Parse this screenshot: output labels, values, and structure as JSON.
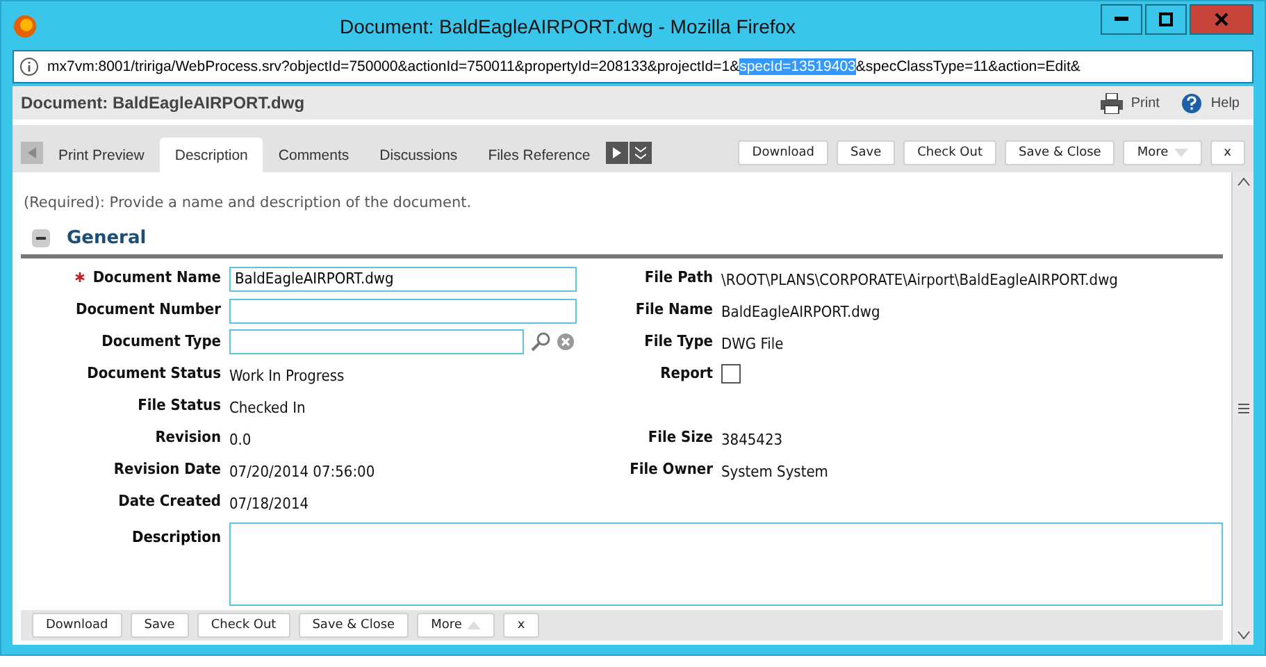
{
  "window": {
    "title": "Document: BaldEagleAIRPORT.dwg - Mozilla Firefox"
  },
  "address_bar": {
    "url_before": "mx7vm:8001/tririga/WebProcess.srv?objectId=750000&actionId=750011&propertyId=208133&projectId=1&",
    "url_selected": "specId=13519403",
    "url_after": "&specClassType=11&action=Edit&"
  },
  "header": {
    "title": "Document: BaldEagleAIRPORT.dwg",
    "actions": [
      {
        "kind": "print",
        "label": "Print"
      },
      {
        "kind": "help",
        "label": "Help"
      }
    ]
  },
  "tabs": [
    {
      "label": "Print Preview",
      "selected": false
    },
    {
      "label": "Description",
      "selected": true
    },
    {
      "label": "Comments",
      "selected": false
    },
    {
      "label": "Discussions",
      "selected": false
    },
    {
      "label": "Files Reference",
      "selected": false
    }
  ],
  "top_buttons": [
    {
      "label": "Download"
    },
    {
      "label": "Save"
    },
    {
      "label": "Check Out"
    },
    {
      "label": "Save & Close"
    },
    {
      "label": "More",
      "kind": "menu"
    },
    {
      "label": "x"
    }
  ],
  "instruction": "(Required): Provide a name and description of the document.",
  "section": {
    "title": "General",
    "expanded": true
  },
  "rows": [
    {
      "left": {
        "label": "Document Name",
        "required": true,
        "kind": "input",
        "value": "BaldEagleAIRPORT.dwg"
      },
      "right": {
        "label": "File Path",
        "kind": "text",
        "value": "\\ROOT\\PLANS\\CORPORATE\\Airport\\BaldEagleAIRPORT.dwg"
      }
    },
    {
      "left": {
        "label": "Document Number",
        "required": false,
        "kind": "input"
      },
      "right": {
        "label": "File Name",
        "kind": "text",
        "value": "BaldEagleAIRPORT.dwg"
      }
    },
    {
      "left": {
        "label": "Document Type",
        "required": false,
        "kind": "lookup"
      },
      "right": {
        "label": "File Type",
        "kind": "text",
        "value": "DWG File"
      }
    },
    {
      "left": {
        "label": "Document Status",
        "required": false,
        "kind": "text",
        "value": "Work In Progress"
      },
      "right": {
        "label": "Report",
        "kind": "checkbox",
        "checked": false
      }
    },
    {
      "left": {
        "label": "File Status",
        "required": false,
        "kind": "text",
        "value": "Checked In"
      }
    },
    {
      "left": {
        "label": "Revision",
        "required": false,
        "kind": "text",
        "value": "0.0"
      },
      "right": {
        "label": "File Size",
        "kind": "text",
        "value": "3845423"
      }
    },
    {
      "left": {
        "label": "Revision Date",
        "required": false,
        "kind": "text",
        "value": "07/20/2014 07:56:00"
      },
      "right": {
        "label": "File Owner",
        "kind": "text",
        "value": "System System"
      }
    },
    {
      "left": {
        "label": "Date Created",
        "required": false,
        "kind": "text",
        "value": "07/18/2014"
      }
    }
  ],
  "description": {
    "label": "Description"
  },
  "bottom_buttons": [
    {
      "label": "Download"
    },
    {
      "label": "Save"
    },
    {
      "label": "Check Out"
    },
    {
      "label": "Save & Close"
    },
    {
      "label": "More",
      "kind": "menu"
    },
    {
      "label": "x"
    }
  ]
}
